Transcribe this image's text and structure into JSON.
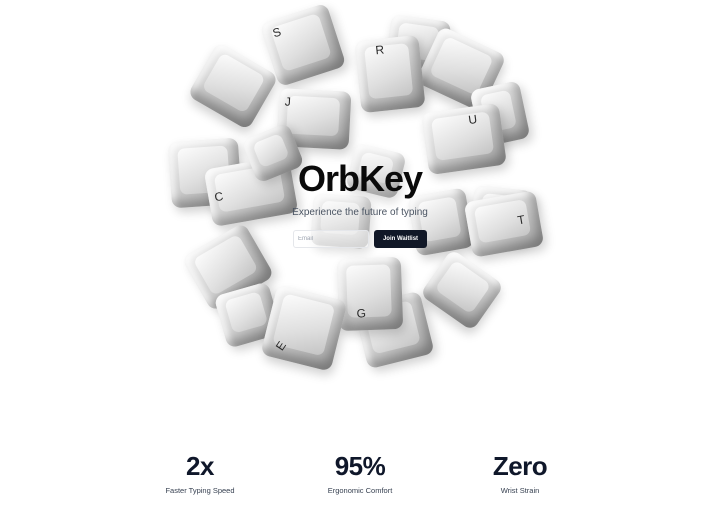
{
  "hero": {
    "title": "OrbKey",
    "tagline": "Experience the future of typing",
    "email_placeholder": "Email",
    "join_label": "Join Waitlist"
  },
  "keycaps": [
    {
      "id": "s",
      "glyph": "S"
    },
    {
      "id": "r",
      "glyph": "R"
    },
    {
      "id": "j",
      "glyph": "J"
    },
    {
      "id": "u",
      "glyph": "U"
    },
    {
      "id": "c",
      "glyph": "C"
    },
    {
      "id": "t",
      "glyph": "T"
    },
    {
      "id": "g",
      "glyph": "G"
    },
    {
      "id": "e",
      "glyph": "E"
    }
  ],
  "stats": [
    {
      "value": "2x",
      "label": "Faster Typing Speed"
    },
    {
      "value": "95%",
      "label": "Ergonomic Comfort"
    },
    {
      "value": "Zero",
      "label": "Wrist Strain"
    }
  ]
}
